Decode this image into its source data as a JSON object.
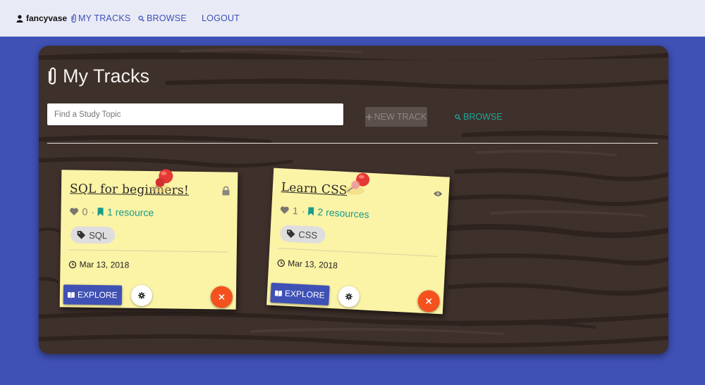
{
  "nav": {
    "username": "fancyvase",
    "my_tracks": "MY TRACKS",
    "browse": "BROWSE",
    "logout": "LOGOUT"
  },
  "page": {
    "title": "My Tracks",
    "search_placeholder": "Find a Study Topic",
    "new_track": "NEW TRACK",
    "browse": "BROWSE"
  },
  "colors": {
    "brand": "#3f51b5",
    "accent": "#1aa89a",
    "danger": "#f4511e",
    "note": "#fbf3a6"
  },
  "cards": [
    {
      "title": "SQL for beginners!",
      "likes": "0",
      "resources": "1 resource",
      "tag": "SQL",
      "date": "Mar 13, 2018",
      "explore": "EXPLORE",
      "status_icon": "lock-icon"
    },
    {
      "title": "Learn CSS",
      "likes": "1",
      "resources": "2 resources",
      "tag": "CSS",
      "date": "Mar 13, 2018",
      "explore": "EXPLORE",
      "status_icon": "eye-icon"
    }
  ]
}
